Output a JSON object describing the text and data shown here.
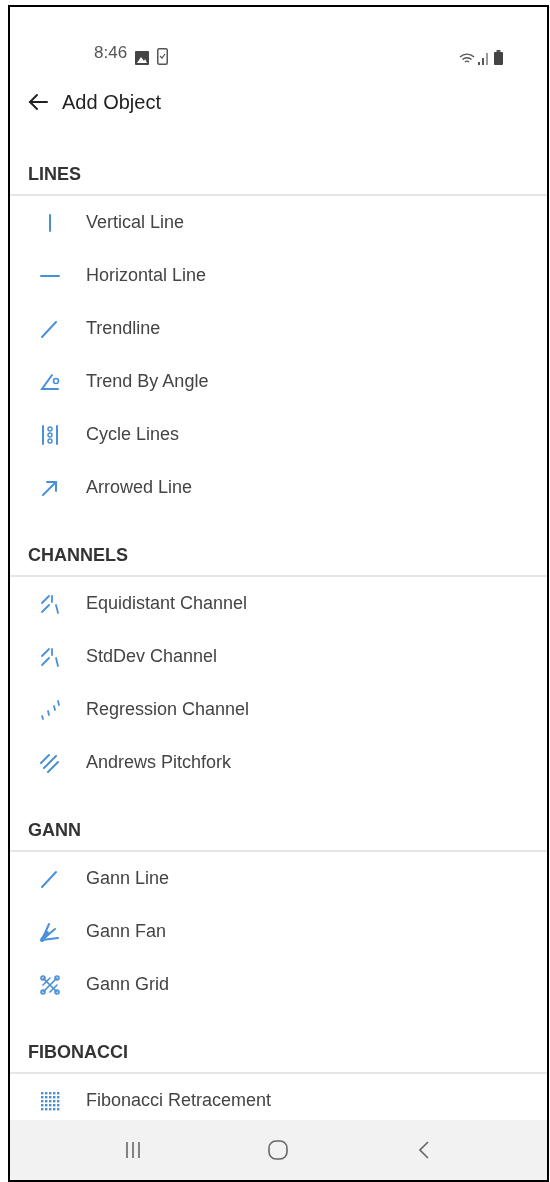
{
  "status_bar": {
    "time": "8:46"
  },
  "app_bar": {
    "title": "Add Object"
  },
  "sections": [
    {
      "title": "LINES",
      "items": [
        {
          "label": "Vertical Line",
          "kind": "vertical"
        },
        {
          "label": "Horizontal Line",
          "kind": "horizontal"
        },
        {
          "label": "Trendline",
          "kind": "trend"
        },
        {
          "label": "Trend By Angle",
          "kind": "angle"
        },
        {
          "label": "Cycle Lines",
          "kind": "cycle"
        },
        {
          "label": "Arrowed Line",
          "kind": "arrow"
        }
      ]
    },
    {
      "title": "CHANNELS",
      "items": [
        {
          "label": "Equidistant Channel",
          "kind": "channel"
        },
        {
          "label": "StdDev Channel",
          "kind": "channel"
        },
        {
          "label": "Regression Channel",
          "kind": "regression"
        },
        {
          "label": "Andrews Pitchfork",
          "kind": "pitchfork"
        }
      ]
    },
    {
      "title": "GANN",
      "items": [
        {
          "label": "Gann Line",
          "kind": "trend"
        },
        {
          "label": "Gann Fan",
          "kind": "fan"
        },
        {
          "label": "Gann Grid",
          "kind": "grid"
        }
      ]
    },
    {
      "title": "FIBONACCI",
      "items": [
        {
          "label": "Fibonacci Retracement",
          "kind": "dots"
        }
      ]
    }
  ]
}
